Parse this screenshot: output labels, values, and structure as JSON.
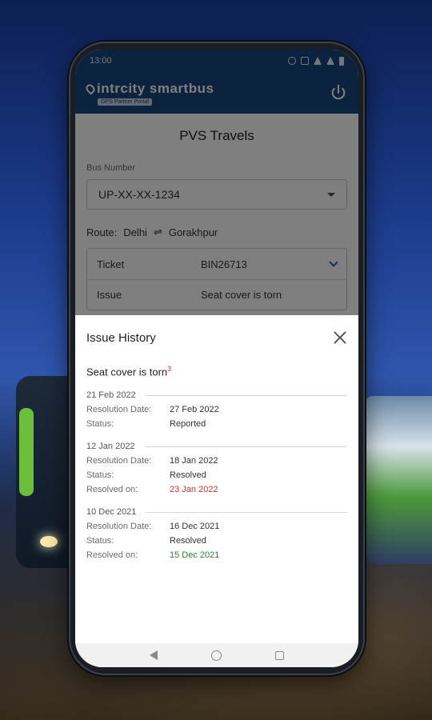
{
  "status": {
    "time": "13:00"
  },
  "app": {
    "brand_name": "intrcity smartbus",
    "brand_tag": "OPS Partner Portal"
  },
  "page": {
    "title": "PVS Travels",
    "bus_number_label": "Bus Number",
    "bus_number_value": "UP-XX-XX-1234",
    "route_label": "Route:",
    "route_from": "Delhi",
    "route_arrow": "⇌",
    "route_to": "Gorakhpur",
    "ticket_label": "Ticket",
    "ticket_value": "BIN26713",
    "issue_label": "Issue",
    "issue_value": "Seat cover is torn"
  },
  "sheet": {
    "title": "Issue History",
    "issue_name": "Seat cover is torn",
    "issue_count": "3",
    "entries": [
      {
        "date": "21 Feb 2022",
        "resolution_label": "Resolution Date:",
        "resolution_date": "27 Feb 2022",
        "status_label": "Status:",
        "status": "Reported"
      },
      {
        "date": "12 Jan 2022",
        "resolution_label": "Resolution Date:",
        "resolution_date": "18 Jan 2022",
        "status_label": "Status:",
        "status": "Resolved",
        "resolved_label": "Resolved on:",
        "resolved_on": "23 Jan 2022"
      },
      {
        "date": "10 Dec 2021",
        "resolution_label": "Resolution Date:",
        "resolution_date": "16 Dec 2021",
        "status_label": "Status:",
        "status": "Resolved",
        "resolved_label": "Resolved on:",
        "resolved_on": "15 Dec 2021"
      }
    ]
  },
  "colors": {
    "appbar": "#17467e",
    "late": "#d93025",
    "on_time": "#2e7d32",
    "accent": "#1a5fb4"
  }
}
